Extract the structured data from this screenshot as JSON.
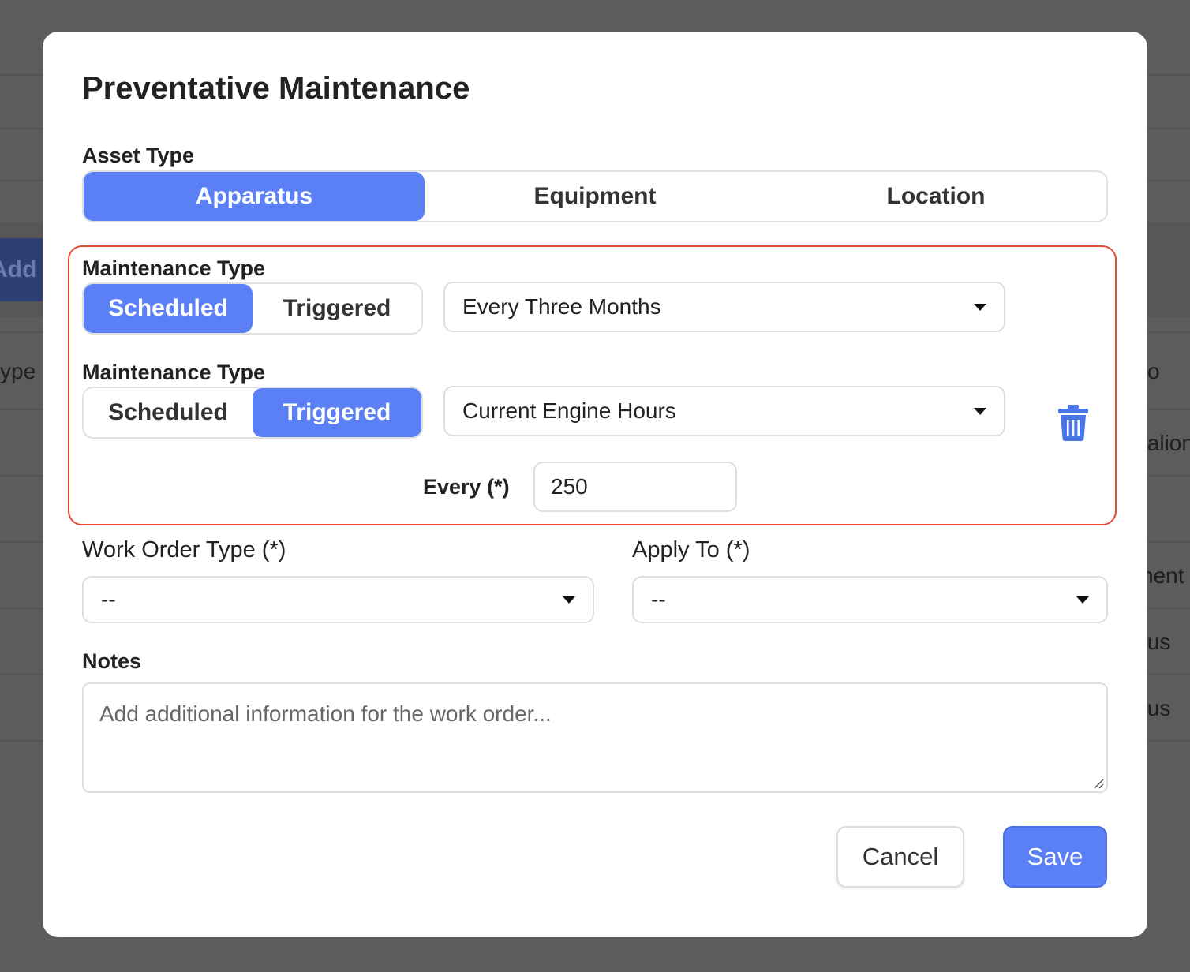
{
  "background": {
    "add_button_label": "Add M",
    "column_header_fragment": "ype",
    "right_fragments": [
      "o",
      "talion",
      "nent",
      "tus",
      "tus"
    ]
  },
  "modal": {
    "title": "Preventative Maintenance",
    "asset_type": {
      "label": "Asset Type",
      "options": [
        "Apparatus",
        "Equipment",
        "Location"
      ],
      "selected": "Apparatus"
    },
    "rules": [
      {
        "label": "Maintenance Type",
        "options": [
          "Scheduled",
          "Triggered"
        ],
        "selected": "Scheduled",
        "frequency": "Every Three Months"
      },
      {
        "label": "Maintenance Type",
        "options": [
          "Scheduled",
          "Triggered"
        ],
        "selected": "Triggered",
        "trigger": "Current Engine Hours",
        "every_label": "Every (*)",
        "every_value": "250",
        "delete_icon": "trash-icon"
      }
    ],
    "work_order_type": {
      "label": "Work Order Type (*)",
      "value": "--"
    },
    "apply_to": {
      "label": "Apply To (*)",
      "value": "--"
    },
    "notes": {
      "label": "Notes",
      "placeholder": "Add additional information for the work order..."
    },
    "cancel_label": "Cancel",
    "save_label": "Save"
  },
  "colors": {
    "accent": "#5b80f5",
    "highlight_border": "#e24b35",
    "overlay": "#5c5c5c"
  }
}
